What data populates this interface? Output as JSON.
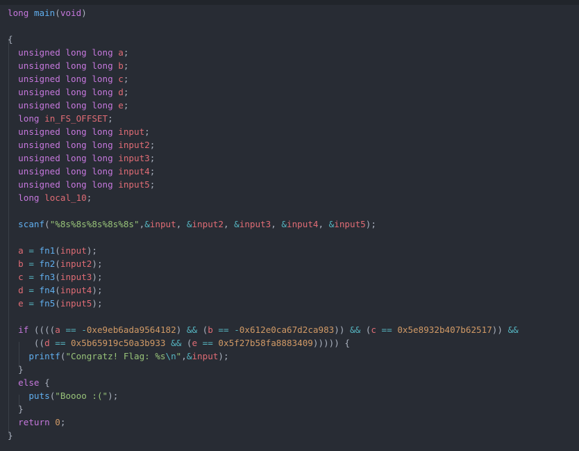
{
  "palette": {
    "background": "#282c34",
    "keyword": "#c678dd",
    "function": "#61afef",
    "variable": "#e06c75",
    "number": "#d19a66",
    "string": "#98c379",
    "escape": "#56b6c2",
    "operator": "#56b6c2",
    "plain": "#abb2bf"
  },
  "lines": [
    [
      [
        "kw",
        "long"
      ],
      [
        "pl",
        " "
      ],
      [
        "fn",
        "main"
      ],
      [
        "pl",
        "("
      ],
      [
        "kw",
        "void"
      ],
      [
        "pl",
        ")"
      ]
    ],
    [],
    [
      [
        "pl",
        "{"
      ]
    ],
    [
      [
        "pl",
        "  "
      ],
      [
        "kw",
        "unsigned long long"
      ],
      [
        "pl",
        " "
      ],
      [
        "var",
        "a"
      ],
      [
        "pl",
        ";"
      ]
    ],
    [
      [
        "pl",
        "  "
      ],
      [
        "kw",
        "unsigned long long"
      ],
      [
        "pl",
        " "
      ],
      [
        "var",
        "b"
      ],
      [
        "pl",
        ";"
      ]
    ],
    [
      [
        "pl",
        "  "
      ],
      [
        "kw",
        "unsigned long long"
      ],
      [
        "pl",
        " "
      ],
      [
        "var",
        "c"
      ],
      [
        "pl",
        ";"
      ]
    ],
    [
      [
        "pl",
        "  "
      ],
      [
        "kw",
        "unsigned long long"
      ],
      [
        "pl",
        " "
      ],
      [
        "var",
        "d"
      ],
      [
        "pl",
        ";"
      ]
    ],
    [
      [
        "pl",
        "  "
      ],
      [
        "kw",
        "unsigned long long"
      ],
      [
        "pl",
        " "
      ],
      [
        "var",
        "e"
      ],
      [
        "pl",
        ";"
      ]
    ],
    [
      [
        "pl",
        "  "
      ],
      [
        "kw",
        "long"
      ],
      [
        "pl",
        " "
      ],
      [
        "var",
        "in_FS_OFFSET"
      ],
      [
        "pl",
        ";"
      ]
    ],
    [
      [
        "pl",
        "  "
      ],
      [
        "kw",
        "unsigned long long"
      ],
      [
        "pl",
        " "
      ],
      [
        "var",
        "input"
      ],
      [
        "pl",
        ";"
      ]
    ],
    [
      [
        "pl",
        "  "
      ],
      [
        "kw",
        "unsigned long long"
      ],
      [
        "pl",
        " "
      ],
      [
        "var",
        "input2"
      ],
      [
        "pl",
        ";"
      ]
    ],
    [
      [
        "pl",
        "  "
      ],
      [
        "kw",
        "unsigned long long"
      ],
      [
        "pl",
        " "
      ],
      [
        "var",
        "input3"
      ],
      [
        "pl",
        ";"
      ]
    ],
    [
      [
        "pl",
        "  "
      ],
      [
        "kw",
        "unsigned long long"
      ],
      [
        "pl",
        " "
      ],
      [
        "var",
        "input4"
      ],
      [
        "pl",
        ";"
      ]
    ],
    [
      [
        "pl",
        "  "
      ],
      [
        "kw",
        "unsigned long long"
      ],
      [
        "pl",
        " "
      ],
      [
        "var",
        "input5"
      ],
      [
        "pl",
        ";"
      ]
    ],
    [
      [
        "pl",
        "  "
      ],
      [
        "kw",
        "long"
      ],
      [
        "pl",
        " "
      ],
      [
        "var",
        "local_10"
      ],
      [
        "pl",
        ";"
      ]
    ],
    [],
    [
      [
        "pl",
        "  "
      ],
      [
        "fn",
        "scanf"
      ],
      [
        "pl",
        "("
      ],
      [
        "str",
        "\"%8s%8s%8s%8s%8s\""
      ],
      [
        "pl",
        ","
      ],
      [
        "op",
        "&"
      ],
      [
        "var",
        "input"
      ],
      [
        "pl",
        ", "
      ],
      [
        "op",
        "&"
      ],
      [
        "var",
        "input2"
      ],
      [
        "pl",
        ", "
      ],
      [
        "op",
        "&"
      ],
      [
        "var",
        "input3"
      ],
      [
        "pl",
        ", "
      ],
      [
        "op",
        "&"
      ],
      [
        "var",
        "input4"
      ],
      [
        "pl",
        ", "
      ],
      [
        "op",
        "&"
      ],
      [
        "var",
        "input5"
      ],
      [
        "pl",
        ");"
      ]
    ],
    [],
    [
      [
        "pl",
        "  "
      ],
      [
        "var",
        "a"
      ],
      [
        "pl",
        " "
      ],
      [
        "op",
        "="
      ],
      [
        "pl",
        " "
      ],
      [
        "fn",
        "fn1"
      ],
      [
        "pl",
        "("
      ],
      [
        "var",
        "input"
      ],
      [
        "pl",
        ");"
      ]
    ],
    [
      [
        "pl",
        "  "
      ],
      [
        "var",
        "b"
      ],
      [
        "pl",
        " "
      ],
      [
        "op",
        "="
      ],
      [
        "pl",
        " "
      ],
      [
        "fn",
        "fn2"
      ],
      [
        "pl",
        "("
      ],
      [
        "var",
        "input2"
      ],
      [
        "pl",
        ");"
      ]
    ],
    [
      [
        "pl",
        "  "
      ],
      [
        "var",
        "c"
      ],
      [
        "pl",
        " "
      ],
      [
        "op",
        "="
      ],
      [
        "pl",
        " "
      ],
      [
        "fn",
        "fn3"
      ],
      [
        "pl",
        "("
      ],
      [
        "var",
        "input3"
      ],
      [
        "pl",
        ");"
      ]
    ],
    [
      [
        "pl",
        "  "
      ],
      [
        "var",
        "d"
      ],
      [
        "pl",
        " "
      ],
      [
        "op",
        "="
      ],
      [
        "pl",
        " "
      ],
      [
        "fn",
        "fn4"
      ],
      [
        "pl",
        "("
      ],
      [
        "var",
        "input4"
      ],
      [
        "pl",
        ");"
      ]
    ],
    [
      [
        "pl",
        "  "
      ],
      [
        "var",
        "e"
      ],
      [
        "pl",
        " "
      ],
      [
        "op",
        "="
      ],
      [
        "pl",
        " "
      ],
      [
        "fn",
        "fn5"
      ],
      [
        "pl",
        "("
      ],
      [
        "var",
        "input5"
      ],
      [
        "pl",
        ");"
      ]
    ],
    [],
    [
      [
        "pl",
        "  "
      ],
      [
        "kw",
        "if"
      ],
      [
        "pl",
        " (((("
      ],
      [
        "var",
        "a"
      ],
      [
        "pl",
        " "
      ],
      [
        "op",
        "=="
      ],
      [
        "pl",
        " "
      ],
      [
        "op",
        "-"
      ],
      [
        "num",
        "0xe9eb6ada9564182"
      ],
      [
        "pl",
        ") "
      ],
      [
        "op",
        "&&"
      ],
      [
        "pl",
        " ("
      ],
      [
        "var",
        "b"
      ],
      [
        "pl",
        " "
      ],
      [
        "op",
        "=="
      ],
      [
        "pl",
        " "
      ],
      [
        "op",
        "-"
      ],
      [
        "num",
        "0x612e0ca67d2ca983"
      ],
      [
        "pl",
        ")) "
      ],
      [
        "op",
        "&&"
      ],
      [
        "pl",
        " ("
      ],
      [
        "var",
        "c"
      ],
      [
        "pl",
        " "
      ],
      [
        "op",
        "=="
      ],
      [
        "pl",
        " "
      ],
      [
        "num",
        "0x5e8932b407b62517"
      ],
      [
        "pl",
        "))"
      ],
      [
        "pl",
        " "
      ],
      [
        "op",
        "&&"
      ]
    ],
    [
      [
        "pl",
        "     (("
      ],
      [
        "var",
        "d"
      ],
      [
        "pl",
        " "
      ],
      [
        "op",
        "=="
      ],
      [
        "pl",
        " "
      ],
      [
        "num",
        "0x5b65919c50a3b933"
      ],
      [
        "pl",
        " "
      ],
      [
        "op",
        "&&"
      ],
      [
        "pl",
        " ("
      ],
      [
        "var",
        "e"
      ],
      [
        "pl",
        " "
      ],
      [
        "op",
        "=="
      ],
      [
        "pl",
        " "
      ],
      [
        "num",
        "0x5f27b58fa8883409"
      ],
      [
        "pl",
        "))))) {"
      ]
    ],
    [
      [
        "pl",
        "    "
      ],
      [
        "fn",
        "printf"
      ],
      [
        "pl",
        "("
      ],
      [
        "str",
        "\"Congratz! Flag: %s"
      ],
      [
        "esc",
        "\\n"
      ],
      [
        "str",
        "\""
      ],
      [
        "pl",
        ","
      ],
      [
        "op",
        "&"
      ],
      [
        "var",
        "input"
      ],
      [
        "pl",
        ");"
      ]
    ],
    [
      [
        "pl",
        "  }"
      ]
    ],
    [
      [
        "pl",
        "  "
      ],
      [
        "kw",
        "else"
      ],
      [
        "pl",
        " {"
      ]
    ],
    [
      [
        "pl",
        "    "
      ],
      [
        "fn",
        "puts"
      ],
      [
        "pl",
        "("
      ],
      [
        "str",
        "\"Boooo :(\""
      ],
      [
        "pl",
        ");"
      ]
    ],
    [
      [
        "pl",
        "  }"
      ]
    ],
    [
      [
        "pl",
        "  "
      ],
      [
        "kw",
        "return"
      ],
      [
        "pl",
        " "
      ],
      [
        "num",
        "0"
      ],
      [
        "pl",
        ";"
      ]
    ],
    [
      [
        "pl",
        "}"
      ]
    ]
  ]
}
